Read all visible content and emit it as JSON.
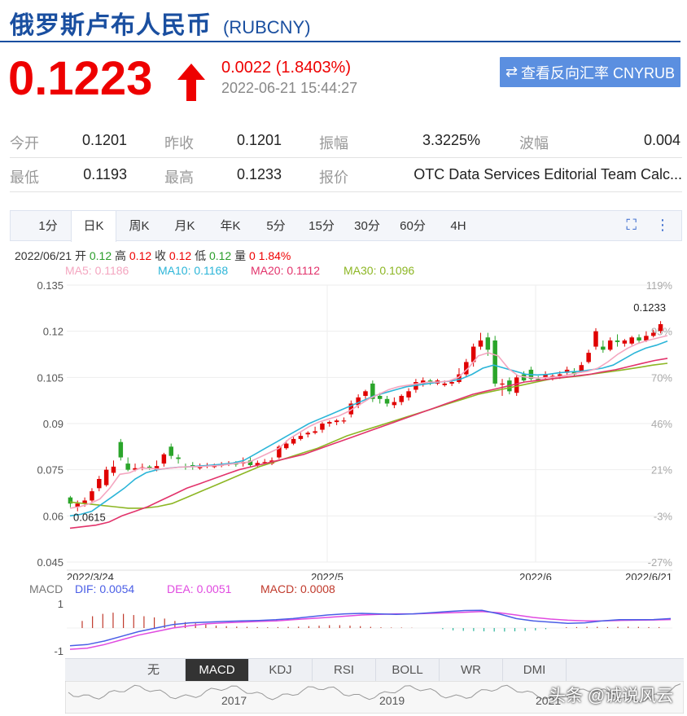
{
  "header": {
    "title": "俄罗斯卢布人民币",
    "code": "(RUBCNY)",
    "price": "0.1223",
    "change": "0.0022 (1.8403%)",
    "time": "2022-06-21 15:44:27",
    "reverse_button": "查看反向汇率 CNYRUB"
  },
  "stats": {
    "row1": [
      {
        "label": "今开",
        "value": "0.1201"
      },
      {
        "label": "昨收",
        "value": "0.1201"
      },
      {
        "label": "振幅",
        "value": "3.3225%"
      },
      {
        "label": "波幅",
        "value": "0.004"
      }
    ],
    "row2": [
      {
        "label": "最低",
        "value": "0.1193"
      },
      {
        "label": "最高",
        "value": "0.1233"
      },
      {
        "label": "报价",
        "value": "OTC Data Services Editorial Team Calc..."
      }
    ]
  },
  "tabs": [
    "1分",
    "日K",
    "周K",
    "月K",
    "年K",
    "5分",
    "15分",
    "30分",
    "60分",
    "4H"
  ],
  "active_tab": "日K",
  "kline_info": {
    "date": "2022/06/21",
    "open_label": "开",
    "open": "0.12",
    "high_label": "高",
    "high": "0.12",
    "close_label": "收",
    "close": "0.12",
    "low_label": "低",
    "low": "0.12",
    "vol_label": "量",
    "vol": "0",
    "pct": "1.84%"
  },
  "ma_legend": [
    {
      "text": "MA5: 0.1186",
      "color": "#f4a6c0"
    },
    {
      "text": "MA10: 0.1168",
      "color": "#2bb5d8"
    },
    {
      "text": "MA20: 0.1112",
      "color": "#e2336b"
    },
    {
      "text": "MA30: 0.1096",
      "color": "#8db624"
    }
  ],
  "macd_legend": [
    {
      "text": "MACD",
      "color": "#777"
    },
    {
      "text": "DIF: 0.0054",
      "color": "#4a5ee6"
    },
    {
      "text": "DEA: 0.0051",
      "color": "#e04ae0"
    },
    {
      "text": "MACD: 0.0008",
      "color": "#c0392b"
    }
  ],
  "indicators": [
    "无",
    "MACD",
    "KDJ",
    "RSI",
    "BOLL",
    "WR",
    "DMI"
  ],
  "active_indicator": "MACD",
  "mini_years": [
    "2017",
    "2019",
    "2021"
  ],
  "watermark": "头条 @诚说风云",
  "colors": {
    "up": "#e00000",
    "down": "#2aa52a",
    "accent": "#1a4fa0",
    "button": "#5b8fe0"
  },
  "icons": [
    "arrow-up-icon",
    "swap-icon",
    "fullscreen-icon",
    "more-icon",
    "triangle-up-icon",
    "triangle-down-icon"
  ],
  "chart_data": {
    "type": "candlestick",
    "y_ticks": [
      "0.135",
      "0.12",
      "0.105",
      "0.09",
      "0.075",
      "0.06",
      "0.045"
    ],
    "ylim": [
      0.045,
      0.135
    ],
    "pct_ticks": [
      "119%",
      "95%",
      "70%",
      "46%",
      "21%",
      "-3%",
      "-27%"
    ],
    "x_labels": [
      "2022/3/24",
      "2022/5",
      "2022/6",
      "2022/6/21"
    ],
    "max_annotation": "0.1233",
    "min_annotation": "0.0615",
    "candles": [
      [
        0.066,
        0.064,
        0.0665,
        0.0628
      ],
      [
        0.063,
        0.064,
        0.065,
        0.0615
      ],
      [
        0.064,
        0.065,
        0.066,
        0.063
      ],
      [
        0.065,
        0.068,
        0.069,
        0.0645
      ],
      [
        0.069,
        0.072,
        0.073,
        0.068
      ],
      [
        0.07,
        0.075,
        0.076,
        0.0695
      ],
      [
        0.074,
        0.076,
        0.078,
        0.073
      ],
      [
        0.084,
        0.079,
        0.085,
        0.078
      ],
      [
        0.077,
        0.075,
        0.079,
        0.0745
      ],
      [
        0.075,
        0.0755,
        0.077,
        0.0745
      ],
      [
        0.0755,
        0.0758,
        0.077,
        0.0748
      ],
      [
        0.076,
        0.0755,
        0.0765,
        0.075
      ],
      [
        0.075,
        0.0762,
        0.078,
        0.0745
      ],
      [
        0.077,
        0.08,
        0.0805,
        0.076
      ],
      [
        0.0825,
        0.0795,
        0.0835,
        0.0785
      ],
      [
        0.079,
        0.0785,
        0.08,
        0.077
      ],
      [
        0.076,
        0.0758,
        0.077,
        0.075
      ],
      [
        0.0765,
        0.076,
        0.0775,
        0.075
      ],
      [
        0.0755,
        0.0758,
        0.077,
        0.075
      ],
      [
        0.0762,
        0.0765,
        0.0772,
        0.0755
      ],
      [
        0.0762,
        0.0762,
        0.077,
        0.0755
      ],
      [
        0.0763,
        0.0768,
        0.0775,
        0.0758
      ],
      [
        0.0768,
        0.077,
        0.0778,
        0.0762
      ],
      [
        0.077,
        0.0768,
        0.0778,
        0.076
      ],
      [
        0.077,
        0.0775,
        0.079,
        0.076
      ],
      [
        0.078,
        0.0765,
        0.079,
        0.076
      ],
      [
        0.0765,
        0.0772,
        0.078,
        0.076
      ],
      [
        0.0775,
        0.0775,
        0.0785,
        0.0768
      ],
      [
        0.077,
        0.078,
        0.079,
        0.0765
      ],
      [
        0.079,
        0.0825,
        0.083,
        0.0785
      ],
      [
        0.082,
        0.0835,
        0.0845,
        0.0815
      ],
      [
        0.0835,
        0.085,
        0.086,
        0.083
      ],
      [
        0.085,
        0.086,
        0.087,
        0.0845
      ],
      [
        0.0865,
        0.087,
        0.0875,
        0.0855
      ],
      [
        0.087,
        0.0875,
        0.089,
        0.0865
      ],
      [
        0.088,
        0.09,
        0.0905,
        0.087
      ],
      [
        0.09,
        0.0905,
        0.091,
        0.089
      ],
      [
        0.0905,
        0.091,
        0.0915,
        0.0895
      ],
      [
        0.091,
        0.091,
        0.092,
        0.09
      ],
      [
        0.093,
        0.0965,
        0.0975,
        0.092
      ],
      [
        0.096,
        0.0985,
        0.0995,
        0.095
      ],
      [
        0.099,
        0.1005,
        0.101,
        0.098
      ],
      [
        0.103,
        0.098,
        0.104,
        0.097
      ],
      [
        0.099,
        0.098,
        0.1,
        0.0965
      ],
      [
        0.098,
        0.0965,
        0.099,
        0.0955
      ],
      [
        0.096,
        0.097,
        0.0985,
        0.095
      ],
      [
        0.097,
        0.099,
        0.0995,
        0.096
      ],
      [
        0.0985,
        0.1005,
        0.1015,
        0.0975
      ],
      [
        0.101,
        0.1035,
        0.1045,
        0.1
      ],
      [
        0.103,
        0.104,
        0.105,
        0.102
      ],
      [
        0.104,
        0.1035,
        0.1045,
        0.1025
      ],
      [
        0.103,
        0.104,
        0.1045,
        0.1025
      ],
      [
        0.1025,
        0.103,
        0.104,
        0.102
      ],
      [
        0.103,
        0.1035,
        0.104,
        0.1022
      ],
      [
        0.1035,
        0.106,
        0.108,
        0.103
      ],
      [
        0.106,
        0.11,
        0.111,
        0.105
      ],
      [
        0.11,
        0.115,
        0.116,
        0.1085
      ],
      [
        0.115,
        0.117,
        0.1195,
        0.114
      ],
      [
        0.118,
        0.114,
        0.1195,
        0.112
      ],
      [
        0.117,
        0.103,
        0.1185,
        0.102
      ],
      [
        0.103,
        0.103,
        0.1045,
        0.099
      ],
      [
        0.104,
        0.1005,
        0.105,
        0.0995
      ],
      [
        0.1,
        0.105,
        0.106,
        0.099
      ],
      [
        0.106,
        0.104,
        0.107,
        0.1035
      ],
      [
        0.1075,
        0.1045,
        0.1085,
        0.104
      ],
      [
        0.1045,
        0.104,
        0.1055,
        0.1035
      ],
      [
        0.105,
        0.106,
        0.107,
        0.104
      ],
      [
        0.105,
        0.1055,
        0.106,
        0.104
      ],
      [
        0.1055,
        0.106,
        0.107,
        0.1045
      ],
      [
        0.1065,
        0.1075,
        0.1085,
        0.1055
      ],
      [
        0.107,
        0.106,
        0.108,
        0.1055
      ],
      [
        0.107,
        0.109,
        0.11,
        0.1065
      ],
      [
        0.11,
        0.113,
        0.114,
        0.1095
      ],
      [
        0.115,
        0.12,
        0.121,
        0.114
      ],
      [
        0.115,
        0.114,
        0.117,
        0.113
      ],
      [
        0.114,
        0.117,
        0.118,
        0.1135
      ],
      [
        0.117,
        0.1165,
        0.119,
        0.115
      ],
      [
        0.116,
        0.117,
        0.1175,
        0.115
      ],
      [
        0.116,
        0.118,
        0.1185,
        0.1155
      ],
      [
        0.118,
        0.117,
        0.119,
        0.116
      ],
      [
        0.117,
        0.1185,
        0.12,
        0.1165
      ],
      [
        0.1185,
        0.1195,
        0.1205,
        0.118
      ],
      [
        0.1201,
        0.1223,
        0.1233,
        0.1193
      ]
    ],
    "ma5": [
      0.0625,
      0.063,
      0.064,
      0.0655,
      0.069,
      0.0735,
      0.074,
      0.0755,
      0.0755,
      0.0752,
      0.0755,
      0.0758,
      0.076,
      0.076,
      0.0762,
      0.0764,
      0.0768,
      0.0772,
      0.0775,
      0.079,
      0.0805,
      0.082,
      0.085,
      0.087,
      0.089,
      0.0905,
      0.0915,
      0.0925,
      0.094,
      0.096,
      0.098,
      0.0995,
      0.101,
      0.102,
      0.1025,
      0.103,
      0.1035,
      0.1035,
      0.1038,
      0.105,
      0.108,
      0.112,
      0.113,
      0.112,
      0.108,
      0.1055,
      0.105,
      0.1048,
      0.105,
      0.1052,
      0.1058,
      0.1065,
      0.107,
      0.108,
      0.11,
      0.1125,
      0.1145,
      0.116,
      0.117,
      0.1178,
      0.1186
    ],
    "ma10": [
      0.06,
      0.0605,
      0.0615,
      0.064,
      0.0665,
      0.069,
      0.072,
      0.074,
      0.075,
      0.0755,
      0.0758,
      0.076,
      0.0762,
      0.0765,
      0.0768,
      0.0772,
      0.078,
      0.08,
      0.082,
      0.084,
      0.086,
      0.088,
      0.09,
      0.0915,
      0.093,
      0.0945,
      0.096,
      0.0975,
      0.099,
      0.1,
      0.101,
      0.102,
      0.1025,
      0.103,
      0.1035,
      0.1038,
      0.1045,
      0.106,
      0.108,
      0.109,
      0.108,
      0.107,
      0.106,
      0.1058,
      0.106,
      0.1065,
      0.1068,
      0.107,
      0.1075,
      0.108,
      0.109,
      0.111,
      0.113,
      0.1145,
      0.1155,
      0.1168
    ],
    "ma20": [
      0.056,
      0.0565,
      0.057,
      0.058,
      0.06,
      0.0615,
      0.063,
      0.065,
      0.067,
      0.069,
      0.0705,
      0.072,
      0.0735,
      0.075,
      0.076,
      0.077,
      0.078,
      0.079,
      0.08,
      0.0815,
      0.083,
      0.0845,
      0.086,
      0.0875,
      0.089,
      0.0905,
      0.092,
      0.0935,
      0.095,
      0.0965,
      0.098,
      0.0995,
      0.1005,
      0.1015,
      0.1025,
      0.1035,
      0.104,
      0.1045,
      0.105,
      0.1055,
      0.106,
      0.1068,
      0.1075,
      0.1085,
      0.1095,
      0.1105,
      0.1112
    ],
    "ma30": [
      0.0645,
      0.064,
      0.0635,
      0.063,
      0.0625,
      0.0625,
      0.063,
      0.064,
      0.066,
      0.068,
      0.07,
      0.072,
      0.074,
      0.076,
      0.0775,
      0.079,
      0.0805,
      0.082,
      0.084,
      0.086,
      0.0875,
      0.089,
      0.0905,
      0.092,
      0.0935,
      0.095,
      0.0965,
      0.098,
      0.0995,
      0.1005,
      0.1015,
      0.1025,
      0.1035,
      0.1045,
      0.105,
      0.1055,
      0.1062,
      0.1068,
      0.1075,
      0.1082,
      0.109,
      0.1096
    ],
    "macd": {
      "ylim": [
        -1,
        1
      ],
      "y_ticks": [
        "1",
        "-1"
      ],
      "dif": [
        -0.75,
        -0.7,
        -0.55,
        -0.35,
        -0.15,
        0.0,
        0.15,
        0.22,
        0.25,
        0.28,
        0.3,
        0.32,
        0.35,
        0.4,
        0.48,
        0.55,
        0.6,
        0.62,
        0.6,
        0.58,
        0.6,
        0.65,
        0.7,
        0.74,
        0.75,
        0.6,
        0.4,
        0.3,
        0.25,
        0.2,
        0.22,
        0.3,
        0.35,
        0.35,
        0.36,
        0.4
      ],
      "dea": [
        -0.9,
        -0.85,
        -0.7,
        -0.5,
        -0.3,
        -0.15,
        0.0,
        0.1,
        0.18,
        0.22,
        0.25,
        0.28,
        0.3,
        0.35,
        0.4,
        0.45,
        0.5,
        0.55,
        0.58,
        0.6,
        0.6,
        0.62,
        0.64,
        0.67,
        0.7,
        0.65,
        0.55,
        0.45,
        0.38,
        0.33,
        0.3,
        0.3,
        0.32,
        0.33,
        0.34,
        0.36
      ],
      "hist": [
        0.0,
        0.3,
        0.5,
        0.6,
        0.65,
        0.6,
        0.55,
        0.5,
        0.45,
        0.4,
        0.3,
        0.25,
        0.2,
        0.15,
        0.1,
        0.08,
        0.06,
        0.05,
        0.04,
        0.03,
        0.04,
        0.05,
        0.06,
        0.08,
        0.1,
        0.12,
        0.12,
        0.1,
        0.08,
        0.05,
        0.03,
        0.02,
        0.02,
        0.01,
        0.0,
        0.0,
        -0.05,
        -0.1,
        -0.12,
        -0.13,
        -0.14,
        -0.15,
        -0.15,
        -0.14,
        -0.12,
        -0.1,
        -0.05,
        0.0,
        0.03,
        0.04,
        0.05,
        0.05,
        0.04,
        0.05,
        0.06,
        0.05,
        0.04,
        0.04
      ]
    }
  }
}
